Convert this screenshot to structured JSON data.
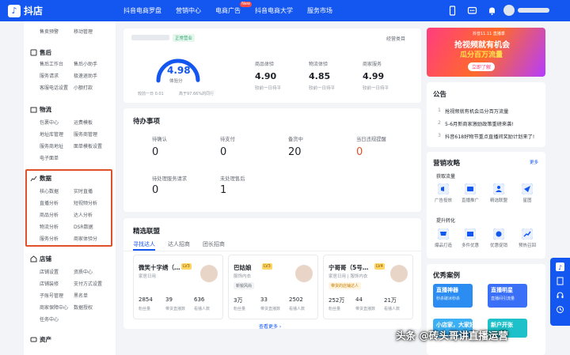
{
  "app": {
    "name": "抖店"
  },
  "nav": {
    "items": [
      "抖音电商罗盘",
      "营销中心",
      "电商广告",
      "抖音电商大学",
      "服务市场"
    ],
    "new_badge": "New"
  },
  "sidebar": {
    "top_items": [
      "售卖预警",
      "移动管理"
    ],
    "groups": [
      {
        "title": "售后",
        "items": [
          "售后工作台",
          "售后小助手",
          "服务请求",
          "极速退助手",
          "客服电话设置",
          "小额打款"
        ]
      },
      {
        "title": "物流",
        "items": [
          "包裹中心",
          "运费模板",
          "地址库管理",
          "服务商管理",
          "服务商地址",
          "面单模板设置",
          "电子面单"
        ]
      },
      {
        "title": "数据",
        "items": [
          "核心数据",
          "实时直播",
          "直播分析",
          "短视频分析",
          "商品分析",
          "达人分析",
          "物流分析",
          "DSR数据",
          "服务分析",
          "商家体验分"
        ]
      },
      {
        "title": "店铺",
        "items": [
          "店铺设置",
          "资质中心",
          "店铺装修",
          "支付方式设置",
          "子账号管理",
          "黑名单",
          "商家保障中心",
          "数据授权",
          "任务中心"
        ]
      },
      {
        "title": "资产",
        "items": []
      }
    ]
  },
  "shop": {
    "status": "正常营业",
    "shop_type_link": "经营类目",
    "score_value": "4.98",
    "score_label": "体验分",
    "score_compare_left": "较前一日 0.01",
    "score_compare_right": "高于97.66%的同行",
    "metrics": [
      {
        "label": "商品体验",
        "value": "4.90",
        "sub": "较前一日持平"
      },
      {
        "label": "物流体验",
        "value": "4.85",
        "sub": "较前一日持平"
      },
      {
        "label": "商家服务",
        "value": "4.99",
        "sub": "较前一日持平"
      }
    ]
  },
  "todo": {
    "title": "待办事项",
    "row1": [
      {
        "label": "待确认",
        "value": "0"
      },
      {
        "label": "待支付",
        "value": "0"
      },
      {
        "label": "备货中",
        "value": "20"
      },
      {
        "label": "当日违规提醒",
        "value": "0"
      }
    ],
    "row2": [
      {
        "label": "待处理服务请求",
        "value": "0"
      },
      {
        "label": "未处理售后",
        "value": "1"
      }
    ]
  },
  "alliance": {
    "title": "精选联盟",
    "tabs": [
      "寻找达人",
      "达人招商",
      "团长招商"
    ],
    "creators": [
      {
        "name": "微笑十字绣（…",
        "tag": "LV3",
        "category": "家居日用",
        "stats": [
          "2854",
          "39",
          "636"
        ],
        "stat_labels": [
          "粉丝量",
          "带货直播数",
          "看播人数"
        ]
      },
      {
        "name": "巴姑娘",
        "tag": "LV3",
        "category": "服饰内衣",
        "badge": "新锐风尚",
        "stats": [
          "3万",
          "33",
          "2502"
        ],
        "stat_labels": [
          "粉丝量",
          "带货直播数",
          "看播人数"
        ]
      },
      {
        "name": "宁哥哥（5号…",
        "tag": "LV4",
        "category": "家居日用 | 服饰内衣",
        "badge": "带货的店铺达人",
        "stats": [
          "252万",
          "44",
          "21万"
        ],
        "stat_labels": [
          "粉丝量",
          "带货直播数",
          "看播人数"
        ]
      }
    ],
    "more": "查看更多"
  },
  "banner": {
    "top": "抖音11.11 直播季",
    "title1": "抢视频就有机会",
    "title2": "瓜分百万流量",
    "button": "立即了解"
  },
  "announcements": {
    "title": "公告",
    "items": [
      {
        "num": "1",
        "text": "抢视频就有机会瓜分百万流量"
      },
      {
        "num": "2",
        "text": "5-6月新商家激励政策重磅来袭!"
      },
      {
        "num": "3",
        "text": "抖音618好物节重点直播间奖励计划来了!"
      }
    ]
  },
  "marketing": {
    "title": "营销攻略",
    "more": "更多",
    "section1": "获取流量",
    "tools1": [
      "广告投放",
      "直播推广",
      "精选联盟",
      "星图"
    ],
    "section2": "提升转化",
    "tools2": [
      "爆品打造",
      "多件优惠",
      "优惠促销",
      "预热召回"
    ]
  },
  "cases": {
    "title": "优秀案例",
    "items": [
      {
        "title": "直播神器",
        "sub": "秒杀破冰秒杀",
        "color": "#2b8cf2"
      },
      {
        "title": "直播明星",
        "sub": "直播间引流量",
        "color": "#3a6ff7"
      },
      {
        "title": "小店家，大家好",
        "sub": "",
        "color": "#3bb0f5"
      },
      {
        "title": "新户开张",
        "sub": "",
        "color": "#1ec1c9"
      }
    ]
  },
  "watermark": "头条 @砖头哥讲直播运营",
  "colors": {
    "brand": "#1456f0",
    "highlight": "#e0512b",
    "status_green": "#2ba471"
  }
}
